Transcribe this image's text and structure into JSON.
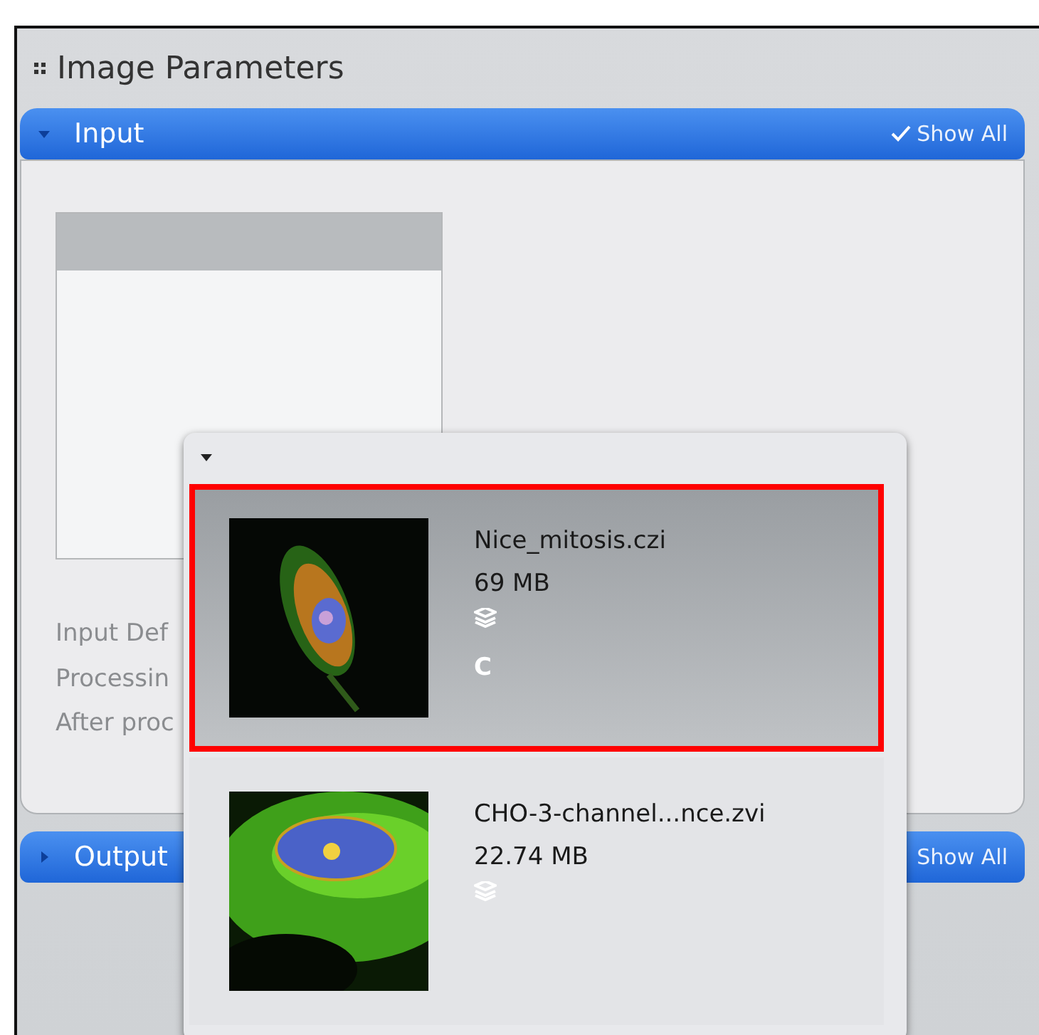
{
  "panel": {
    "title": "Image Parameters"
  },
  "sections": [
    {
      "label": "Input",
      "expanded": true,
      "show_all": "Show All",
      "checked": true
    },
    {
      "label": "Output",
      "expanded": false,
      "show_all": "Show All",
      "checked": false
    }
  ],
  "input_labels": [
    "Input Def",
    "Processin",
    "After proc"
  ],
  "dropdown": {
    "items": [
      {
        "name": "Nice_mitosis.czi",
        "size": "69 MB",
        "channel": "C",
        "selected": true,
        "highlighted": true
      },
      {
        "name": "CHO-3-channel...nce.zvi",
        "size": "22.74 MB",
        "selected": false,
        "highlighted": false
      }
    ]
  }
}
